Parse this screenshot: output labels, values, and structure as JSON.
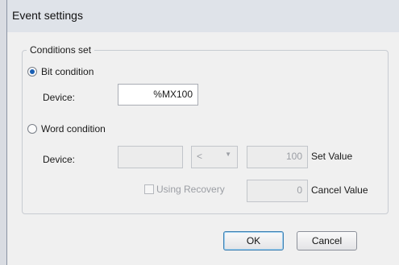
{
  "window": {
    "title": "Event settings"
  },
  "conditions": {
    "legend": "Conditions set",
    "bit": {
      "label": "Bit condition",
      "selected": true,
      "device_label": "Device:",
      "device_value": "%MX100"
    },
    "word": {
      "label": "Word condition",
      "selected": false,
      "device_label": "Device:",
      "device_value": "",
      "operator": "<",
      "set_value": "100",
      "set_value_label": "Set Value",
      "using_recovery_label": "Using Recovery",
      "using_recovery_checked": false,
      "cancel_value": "0",
      "cancel_value_label": "Cancel Value"
    }
  },
  "buttons": {
    "ok": "OK",
    "cancel": "Cancel"
  },
  "colors": {
    "radio_selected": "#1a5fb4",
    "default_button_border": "#3c7fb1"
  }
}
